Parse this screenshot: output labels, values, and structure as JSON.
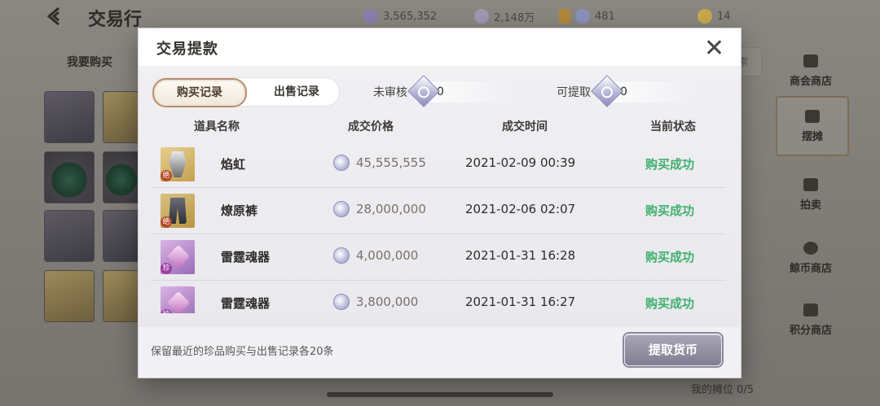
{
  "background": {
    "title": "交易行",
    "resources": [
      {
        "icon": "silver-coin-icon",
        "value": "3,565,352"
      },
      {
        "icon": "jing-coin-icon",
        "value": "2,148万"
      },
      {
        "icon": "bound-coin-icon",
        "value": "481"
      },
      {
        "icon": "gold-coin-icon",
        "value": "14"
      }
    ],
    "tab": "我要购买",
    "search_hint": "索",
    "side_menu": [
      {
        "label": "商会商店",
        "icon": "merchant-icon"
      },
      {
        "label": "摆摊",
        "icon": "stall-icon",
        "active": true
      },
      {
        "label": "拍卖",
        "icon": "hammer-icon"
      },
      {
        "label": "鲸币商店",
        "icon": "whale-coin-icon"
      },
      {
        "label": "积分商店",
        "icon": "points-shop-icon"
      }
    ],
    "stall_count": "我的摊位 0/5"
  },
  "modal": {
    "title": "交易提款",
    "tabs": [
      {
        "label": "购买记录",
        "active": true
      },
      {
        "label": "出售记录",
        "active": false
      }
    ],
    "unreviewed": {
      "label": "未审核",
      "value": "0"
    },
    "withdrawable": {
      "label": "可提取",
      "value": "0"
    },
    "columns": {
      "item": "道具名称",
      "price": "成交价格",
      "time": "成交时间",
      "status": "当前状态"
    },
    "rows": [
      {
        "name": "焰虹",
        "price": "45,555,555",
        "time": "2021-02-09 00:39",
        "status": "购买成功",
        "grade": "绝",
        "icon": "weapon-icon"
      },
      {
        "name": "燎原裤",
        "price": "28,000,000",
        "time": "2021-02-06 02:07",
        "status": "购买成功",
        "grade": "绝",
        "icon": "pants-icon"
      },
      {
        "name": "雷霆魂器",
        "price": "4,000,000",
        "time": "2021-01-31 16:28",
        "status": "购买成功",
        "grade": "珍",
        "icon": "soul-artifact-icon"
      },
      {
        "name": "雷霆魂器",
        "price": "3,800,000",
        "time": "2021-01-31 16:27",
        "status": "购买成功",
        "grade": "珍",
        "icon": "soul-artifact-icon"
      }
    ],
    "footer_note": "保留最近的珍品购买与出售记录各20条",
    "withdraw_button": "提取货币",
    "colors": {
      "success": "#3fb06e",
      "tab_border": "#b78d6b"
    }
  }
}
